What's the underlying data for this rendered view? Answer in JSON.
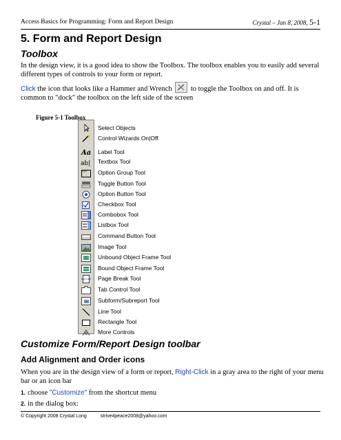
{
  "header": {
    "left": "Access Basics for Programming: Form and Report Design",
    "author": "Crystal",
    "date": "Jan 8, 2008,",
    "page": "5-1"
  },
  "title": "5.  Form and Report Design",
  "toolbox_section": {
    "heading": "Toolbox",
    "para1": "In the design view, it is a good idea to show the Toolbox.  The toolbox enables you to easily add several different types of controls to your form or report.",
    "click_word": "Click",
    "para2_a": " the icon that looks like a Hammer and Wrench ",
    "para2_b": " to toggle the Toolbox on and off.  It is common to \"dock\" the toolbox on the left side of the screen"
  },
  "figure": {
    "caption": "Figure 5-1 Toolbox",
    "tools": [
      {
        "label": "Select Objects",
        "icon": "arrow-icon"
      },
      {
        "label": "Control Wizards On|Off",
        "icon": "wand-icon"
      },
      {
        "label": "Label Tool",
        "icon": "label-icon"
      },
      {
        "label": "Textbox Tool",
        "icon": "textbox-icon"
      },
      {
        "label": "Option Group Tool",
        "icon": "option-group-icon"
      },
      {
        "label": "Toggle Button Tool",
        "icon": "toggle-icon"
      },
      {
        "label": "Option Button Tool",
        "icon": "radio-icon"
      },
      {
        "label": "Checkbox Tool",
        "icon": "checkbox-icon"
      },
      {
        "label": "Combobox Tool",
        "icon": "combobox-icon"
      },
      {
        "label": "Listbox Tool",
        "icon": "listbox-icon"
      },
      {
        "label": "Command Button Tool",
        "icon": "button-icon"
      },
      {
        "label": "Image Tool",
        "icon": "image-icon"
      },
      {
        "label": "Unbound Object Frame Tool",
        "icon": "unbound-frame-icon"
      },
      {
        "label": "Bound Object Frame Tool",
        "icon": "bound-frame-icon"
      },
      {
        "label": "Page Break Tool",
        "icon": "page-break-icon"
      },
      {
        "label": "Tab Control Tool",
        "icon": "tab-icon"
      },
      {
        "label": "Subform/Subreport Tool",
        "icon": "subform-icon"
      },
      {
        "label": "Line Tool",
        "icon": "line-icon"
      },
      {
        "label": "Rectangle Tool",
        "icon": "rectangle-icon"
      },
      {
        "label": "More Controls",
        "icon": "more-controls-icon"
      }
    ]
  },
  "customize_section": {
    "heading": "Customize Form/Report Design toolbar",
    "subheading": "Add Alignment and Order icons",
    "para_a": "When you are in the design view of a form or report, ",
    "right_click": "Right-Click",
    "para_b": " in a gray area to the right of your menu bar or an icon bar",
    "step1_num": "1.",
    "step1_a": "choose ",
    "step1_quote": "\"Customize\"",
    "step1_b": " from the shortcut menu",
    "step2_num": "2.",
    "step2": "in the dialog box:"
  },
  "footer": {
    "copyright": "© Copyright 2008 Crystal Long",
    "email": "strive4peace2008@yahoo.com"
  }
}
